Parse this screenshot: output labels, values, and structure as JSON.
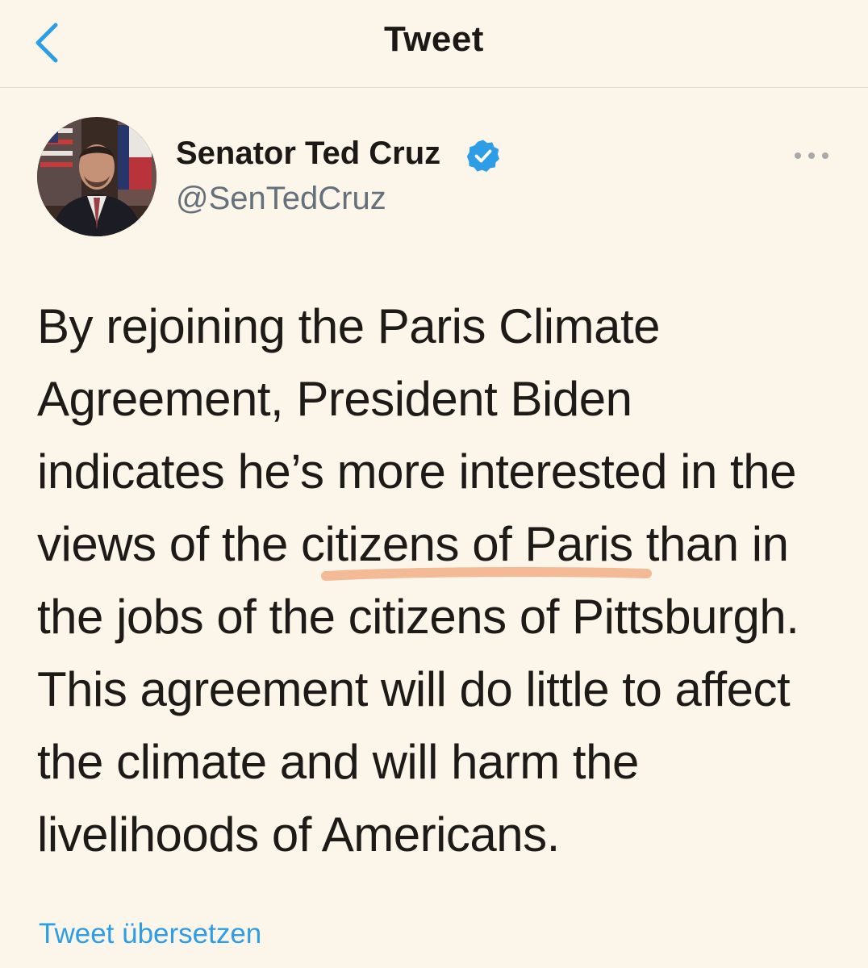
{
  "header": {
    "back_icon": "chevron-left-icon",
    "title": "Tweet"
  },
  "tweet": {
    "author_name": "Senator Ted Cruz",
    "handle": "@SenTedCruz",
    "verified_icon": "verified-badge-icon",
    "more_icon": "more-horizontal-icon",
    "text_lines": [
      "By rejoining the Paris Climate",
      "Agreement, President Biden",
      "indicates he’s more interested in the",
      "views of the citizens of Paris than in",
      "the jobs of the citizens of Pittsburgh.",
      "This agreement will do little to affect",
      "the climate and will harm the",
      "livelihoods of Americans."
    ],
    "highlighted_phrase": "citizens of Paris",
    "translate_label": "Tweet übersetzen"
  },
  "colors": {
    "background": "#fbf5ea",
    "accent": "#2d9ee6",
    "handle": "#65707a",
    "highlight_stroke": "#f3b48c"
  }
}
